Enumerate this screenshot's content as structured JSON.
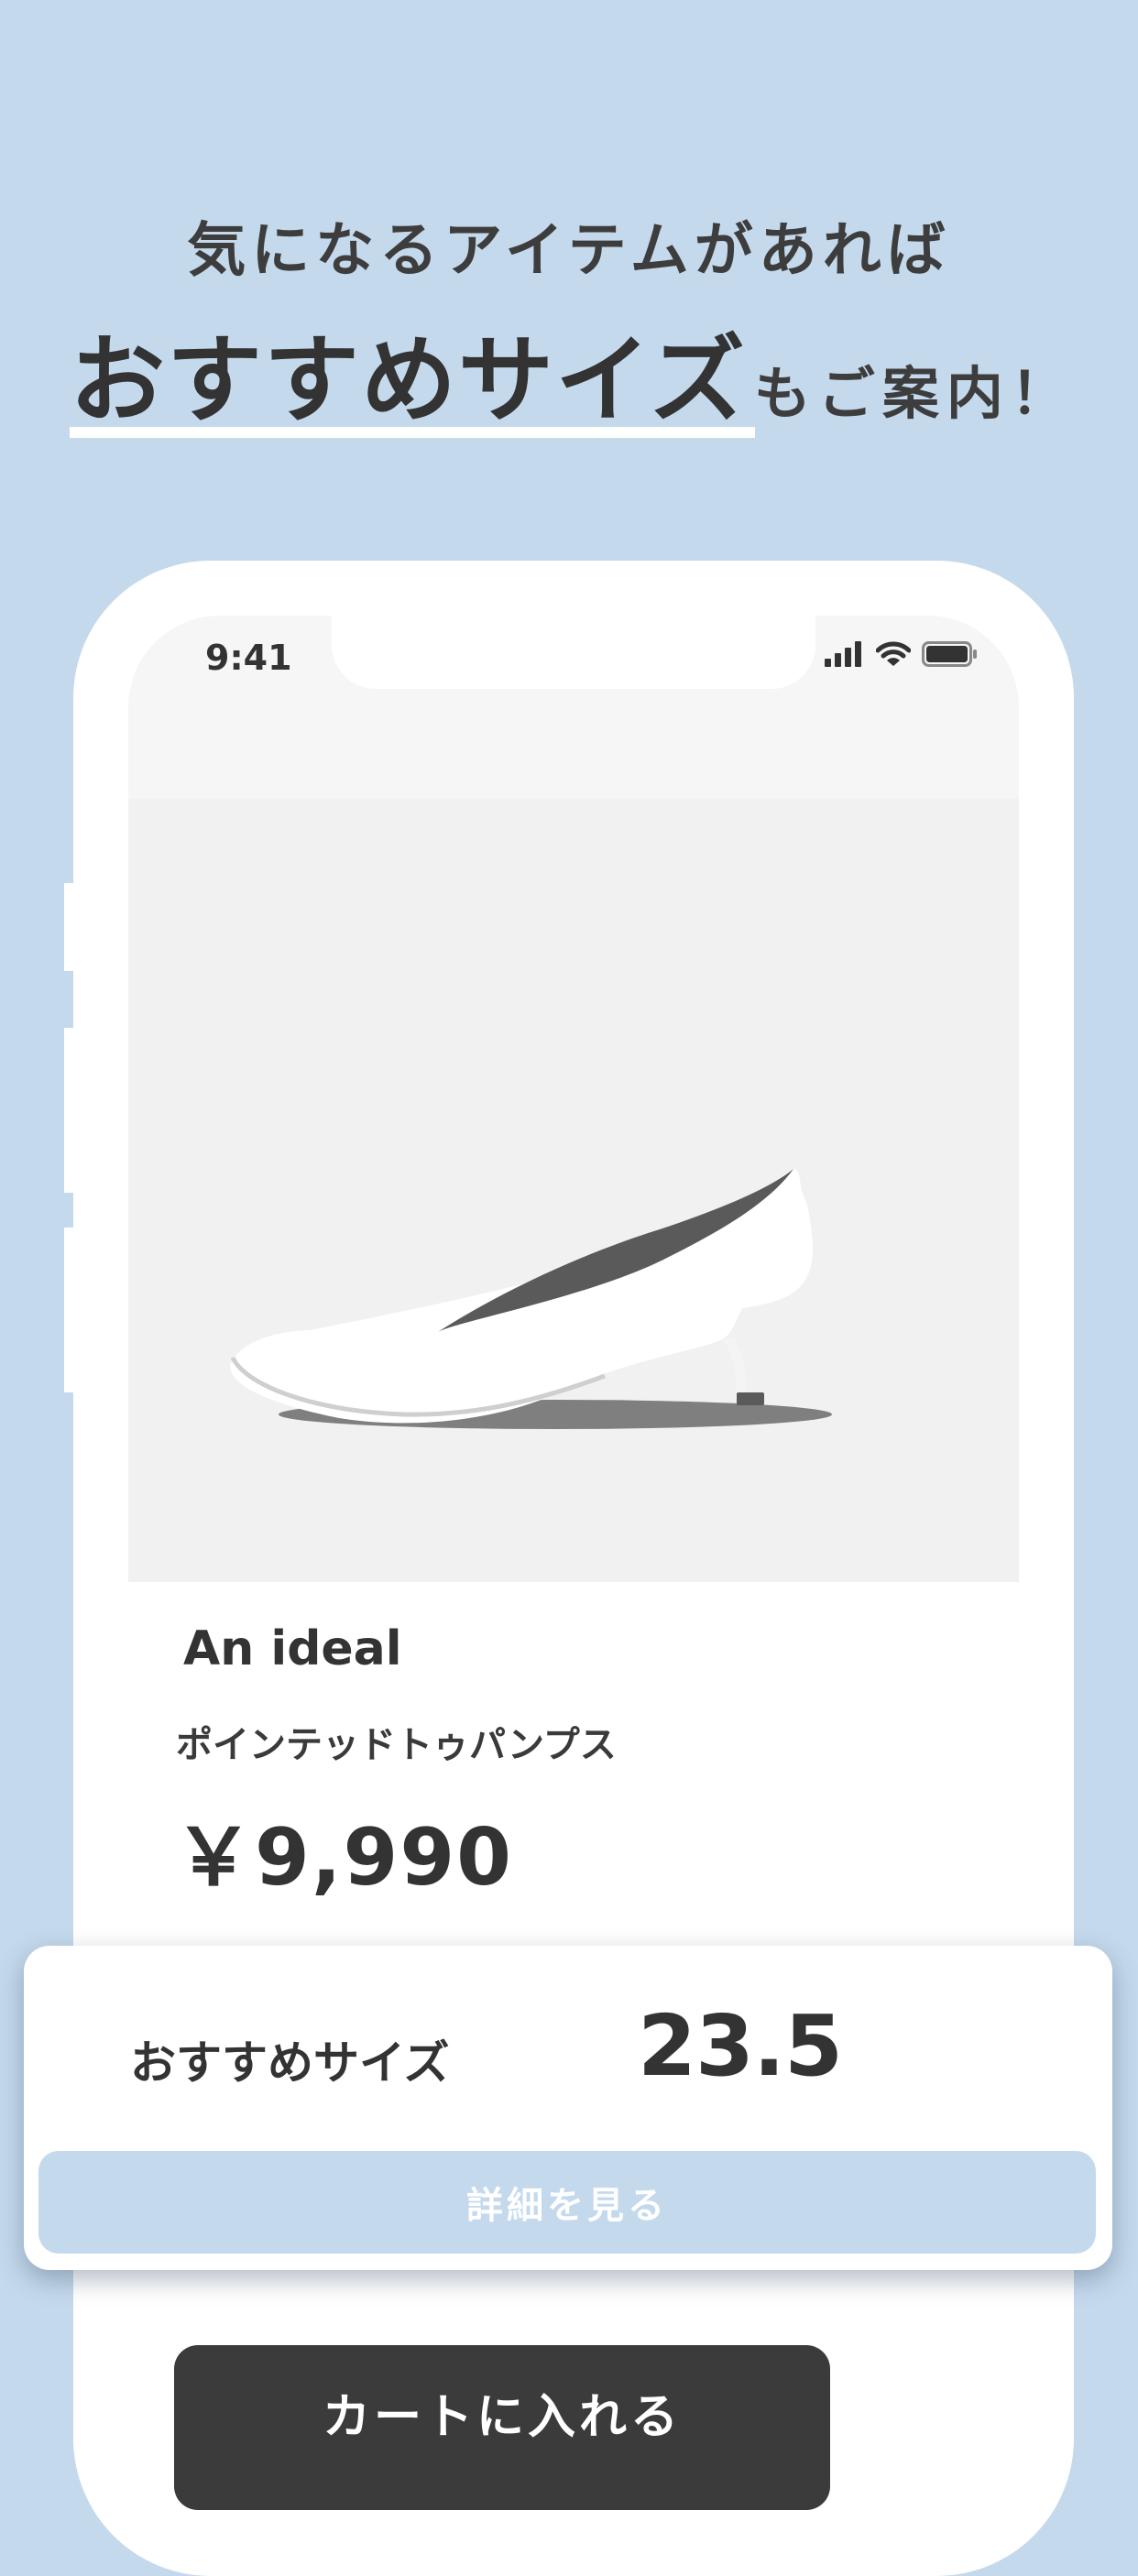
{
  "promo": {
    "line1": "気になるアイテムがあれば",
    "line2_emphasis": "おすすめサイズ",
    "line2_rest": "もご案内！"
  },
  "status_bar": {
    "time": "9:41",
    "icons": [
      "signal-icon",
      "wifi-icon",
      "battery-icon"
    ]
  },
  "product": {
    "image": "pump-shoe-image",
    "brand": "An ideal",
    "name": "ポインテッドトゥパンプス",
    "price": "￥9,990"
  },
  "recommendation": {
    "label": "おすすめサイズ",
    "size": "23.5",
    "details_button": "詳細を見る"
  },
  "cart_button": "カートに入れる",
  "colors": {
    "background": "#c5d9ed",
    "dark_button": "#3b3b3b",
    "text": "#333333"
  }
}
